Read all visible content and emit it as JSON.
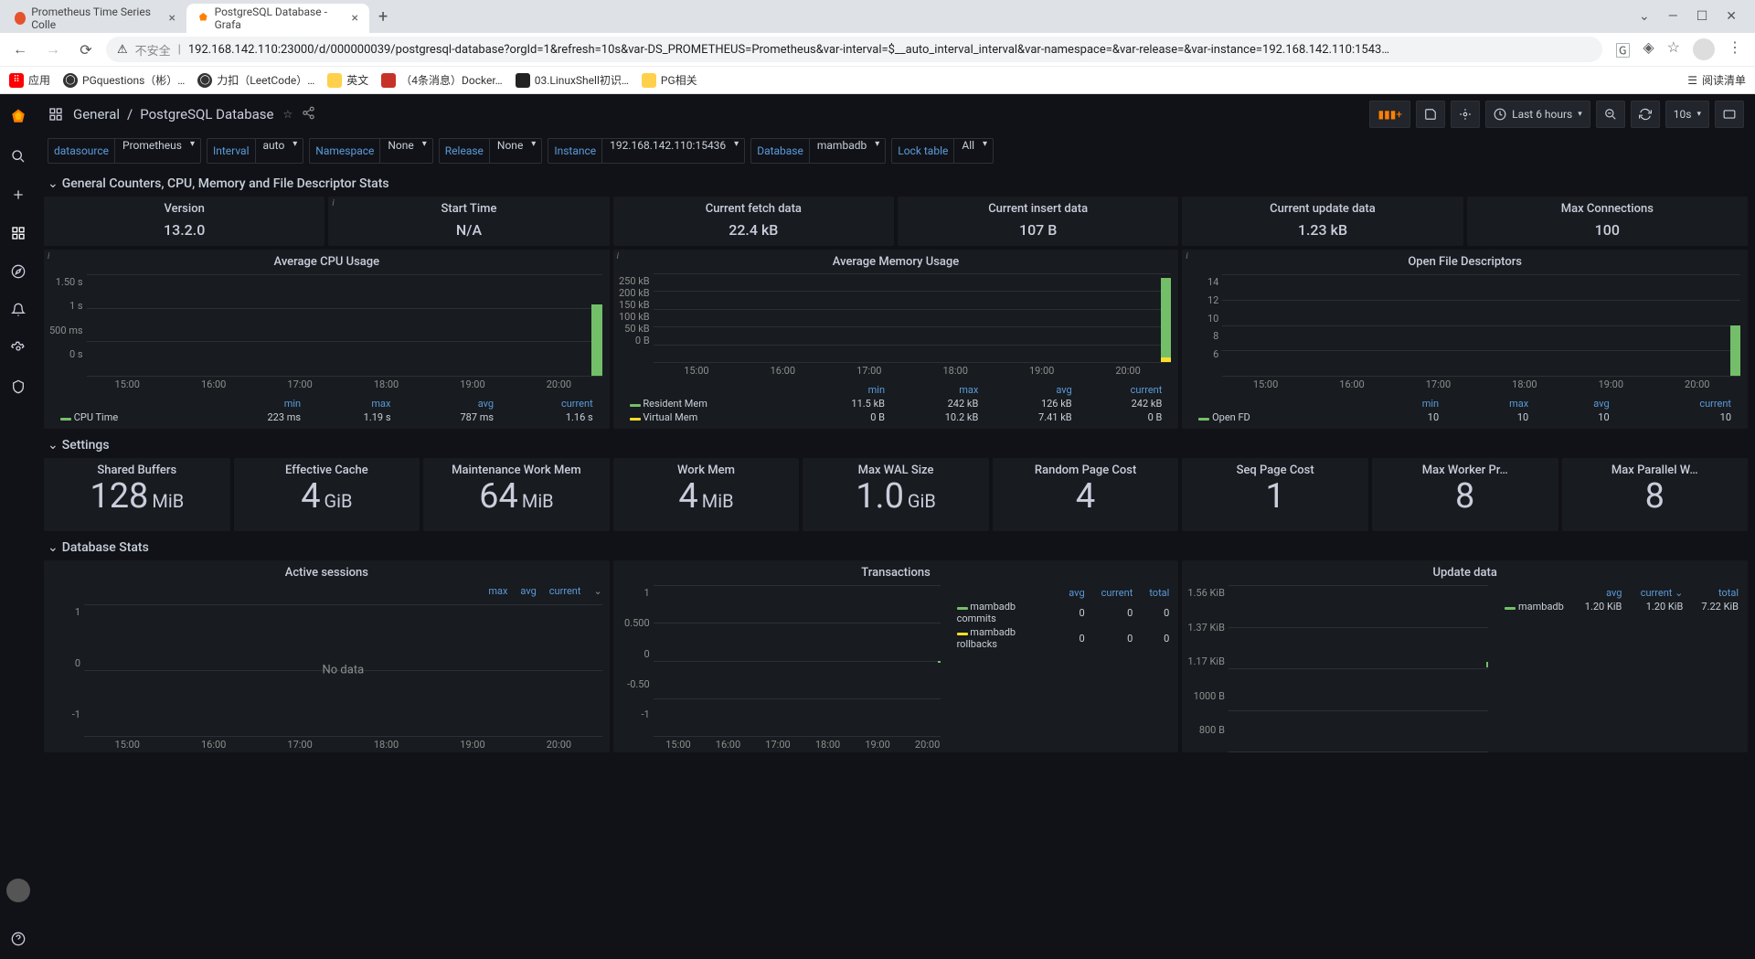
{
  "browser": {
    "tabs": [
      {
        "title": "Prometheus Time Series Colle",
        "favicon_color": "#e6522c"
      },
      {
        "title": "PostgreSQL Database - Grafa",
        "favicon_color": "#ff8000"
      }
    ],
    "url_prefix": "不安全",
    "url": "192.168.142.110:23000/d/000000039/postgresql-database?orgId=1&refresh=10s&var-DS_PROMETHEUS=Prometheus&var-interval=$__auto_interval_interval&var-namespace=&var-release=&var-instance=192.168.142.110:1543…",
    "bookmarks_label": "应用",
    "bookmarks": [
      "PGquestions（彬）…",
      "力扣（LeetCode）…",
      "英文",
      "（4条消息）Docker…",
      "03.LinuxShell初识…",
      "PG相关"
    ],
    "reading_list": "阅读清单"
  },
  "header": {
    "folder": "General",
    "title": "PostgreSQL Database",
    "time_range": "Last 6 hours",
    "refresh": "10s"
  },
  "vars": {
    "datasource": {
      "label": "datasource",
      "value": "Prometheus"
    },
    "interval": {
      "label": "Interval",
      "value": "auto"
    },
    "namespace": {
      "label": "Namespace",
      "value": "None"
    },
    "release": {
      "label": "Release",
      "value": "None"
    },
    "instance": {
      "label": "Instance",
      "value": "192.168.142.110:15436"
    },
    "database": {
      "label": "Database",
      "value": "mambadb"
    },
    "locktable": {
      "label": "Lock table",
      "value": "All"
    }
  },
  "rows": {
    "counters": "General Counters, CPU, Memory and File Descriptor Stats",
    "settings": "Settings",
    "dbstats": "Database Stats"
  },
  "stats": {
    "version": {
      "title": "Version",
      "value": "13.2.0"
    },
    "start_time": {
      "title": "Start Time",
      "value": "N/A"
    },
    "fetch": {
      "title": "Current fetch data",
      "value": "22.4 kB"
    },
    "insert": {
      "title": "Current insert data",
      "value": "107 B"
    },
    "update": {
      "title": "Current update data",
      "value": "1.23 kB"
    },
    "maxconn": {
      "title": "Max Connections",
      "value": "100"
    }
  },
  "cpu": {
    "title": "Average CPU Usage",
    "y": [
      "1.50 s",
      "1 s",
      "500 ms",
      "0 s"
    ],
    "x": [
      "15:00",
      "16:00",
      "17:00",
      "18:00",
      "19:00",
      "20:00"
    ],
    "series": [
      {
        "name": "CPU Time",
        "min": "223 ms",
        "max": "1.19 s",
        "avg": "787 ms",
        "current": "1.16 s"
      }
    ],
    "headers": [
      "min",
      "max",
      "avg",
      "current"
    ]
  },
  "mem": {
    "title": "Average Memory Usage",
    "y": [
      "250 kB",
      "200 kB",
      "150 kB",
      "100 kB",
      "50 kB",
      "0 B"
    ],
    "x": [
      "15:00",
      "16:00",
      "17:00",
      "18:00",
      "19:00",
      "20:00"
    ],
    "headers": [
      "min",
      "max",
      "avg",
      "current"
    ],
    "series": [
      {
        "name": "Resident Mem",
        "min": "11.5 kB",
        "max": "242 kB",
        "avg": "126 kB",
        "current": "242 kB"
      },
      {
        "name": "Virtual Mem",
        "min": "0 B",
        "max": "10.2 kB",
        "avg": "7.41 kB",
        "current": "0 B"
      }
    ]
  },
  "fd": {
    "title": "Open File Descriptors",
    "y": [
      "14",
      "12",
      "10",
      "8",
      "6"
    ],
    "x": [
      "15:00",
      "16:00",
      "17:00",
      "18:00",
      "19:00",
      "20:00"
    ],
    "headers": [
      "min",
      "max",
      "avg",
      "current"
    ],
    "series": [
      {
        "name": "Open FD",
        "min": "10",
        "max": "10",
        "avg": "10",
        "current": "10"
      }
    ]
  },
  "settings": {
    "shared_buffers": {
      "title": "Shared Buffers",
      "value": "128",
      "unit": "MiB"
    },
    "effective_cache": {
      "title": "Effective Cache",
      "value": "4",
      "unit": "GiB"
    },
    "maint_work_mem": {
      "title": "Maintenance Work Mem",
      "value": "64",
      "unit": "MiB"
    },
    "work_mem": {
      "title": "Work Mem",
      "value": "4",
      "unit": "MiB"
    },
    "max_wal": {
      "title": "Max WAL Size",
      "value": "1.0",
      "unit": "GiB"
    },
    "random_page": {
      "title": "Random Page Cost",
      "value": "4",
      "unit": ""
    },
    "seq_page": {
      "title": "Seq Page Cost",
      "value": "1",
      "unit": ""
    },
    "max_worker": {
      "title": "Max Worker Pr…",
      "value": "8",
      "unit": ""
    },
    "max_parallel": {
      "title": "Max Parallel W…",
      "value": "8",
      "unit": ""
    }
  },
  "sessions": {
    "title": "Active sessions",
    "y": [
      "1",
      "0",
      "-1"
    ],
    "x": [
      "15:00",
      "16:00",
      "17:00",
      "18:00",
      "19:00",
      "20:00"
    ],
    "nodata": "No data",
    "headers": [
      "max",
      "avg",
      "current"
    ]
  },
  "trans": {
    "title": "Transactions",
    "y": [
      "1",
      "0.500",
      "0",
      "-0.50",
      "-1"
    ],
    "x": [
      "15:00",
      "16:00",
      "17:00",
      "18:00",
      "19:00",
      "20:00"
    ],
    "headers": [
      "avg",
      "current",
      "total"
    ],
    "series": [
      {
        "name": "mambadb commits",
        "avg": "0",
        "current": "0",
        "total": "0"
      },
      {
        "name": "mambadb rollbacks",
        "avg": "0",
        "current": "0",
        "total": "0"
      }
    ]
  },
  "updatedata": {
    "title": "Update data",
    "y": [
      "1.56 KiB",
      "1.37 KiB",
      "1.17 KiB",
      "1000 B",
      "800 B"
    ],
    "headers": [
      "avg",
      "current",
      "total"
    ],
    "series": [
      {
        "name": "mambadb",
        "avg": "1.20 KiB",
        "current": "1.20 KiB",
        "total": "7.22 KiB"
      }
    ]
  }
}
